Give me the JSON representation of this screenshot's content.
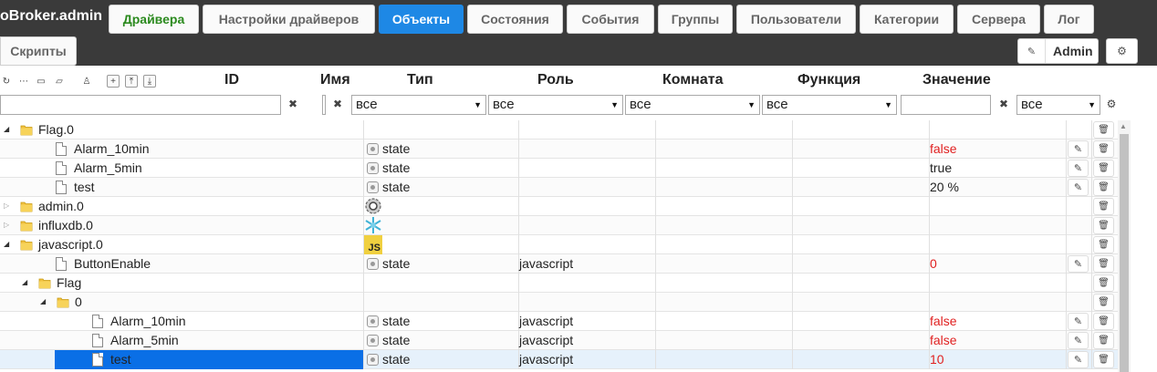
{
  "brand": "oBroker.admin",
  "tabs": [
    {
      "label": "Драйвера"
    },
    {
      "label": "Настройки драйверов"
    },
    {
      "label": "Объекты"
    },
    {
      "label": "Состояния"
    },
    {
      "label": "События"
    },
    {
      "label": "Группы"
    },
    {
      "label": "Пользователи"
    },
    {
      "label": "Категории"
    },
    {
      "label": "Сервера"
    },
    {
      "label": "Лог"
    },
    {
      "label": "Скрипты"
    }
  ],
  "active_tab": "Объекты",
  "user": {
    "name": "Admin"
  },
  "colors": {
    "topbar": "#3a3a3a",
    "active_tab": "#1e88e5",
    "first_tab_text": "#2b8a1e",
    "value_red": "#e02020",
    "selection": "#0a6fe6"
  },
  "columns": {
    "id": "ID",
    "name": "Имя",
    "type": "Тип",
    "role": "Роль",
    "room": "Комната",
    "function": "Функция",
    "value": "Значение"
  },
  "filters": {
    "id": "",
    "name": "",
    "type": "все",
    "role": "все",
    "room": "все",
    "function": "все",
    "value": "",
    "last": "все"
  },
  "toolbar_icons": [
    "refresh-icon",
    "list-icon",
    "folder-icon",
    "folder-open-icon",
    "user-icon",
    "plus-icon",
    "upload-icon",
    "download-icon"
  ],
  "rows": [
    {
      "id": "Flag.0",
      "kind": "folder",
      "level": 0,
      "expand": "open",
      "type": "",
      "role": "",
      "value": "",
      "value_color": "",
      "icon": "",
      "edit": false
    },
    {
      "id": "Alarm_10min",
      "kind": "file",
      "level": 1,
      "expand": "",
      "type": "state",
      "role": "",
      "value": "false",
      "value_color": "red",
      "icon": "state-icon",
      "edit": true
    },
    {
      "id": "Alarm_5min",
      "kind": "file",
      "level": 1,
      "expand": "",
      "type": "state",
      "role": "",
      "value": "true",
      "value_color": "",
      "icon": "state-icon",
      "edit": true
    },
    {
      "id": "test",
      "kind": "file",
      "level": 1,
      "expand": "",
      "type": "state",
      "role": "",
      "value": "20 %",
      "value_color": "",
      "icon": "state-icon",
      "edit": true
    },
    {
      "id": "admin.0",
      "kind": "folder",
      "level": 0,
      "expand": "closed",
      "type": "",
      "role": "",
      "value": "",
      "value_color": "",
      "icon": "admin-gear-icon",
      "edit": false
    },
    {
      "id": "influxdb.0",
      "kind": "folder",
      "level": 0,
      "expand": "closed",
      "type": "",
      "role": "",
      "value": "",
      "value_color": "",
      "icon": "influxdb-icon",
      "edit": false
    },
    {
      "id": "javascript.0",
      "kind": "folder",
      "level": 0,
      "expand": "open",
      "type": "",
      "role": "",
      "value": "",
      "value_color": "",
      "icon": "javascript-icon",
      "icon_text": "JS",
      "edit": false
    },
    {
      "id": "ButtonEnable",
      "kind": "file",
      "level": 1,
      "expand": "",
      "type": "state",
      "role": "javascript",
      "value": "0",
      "value_color": "red",
      "icon": "state-icon",
      "edit": true
    },
    {
      "id": "Flag",
      "kind": "folder",
      "level": 1,
      "expand": "open",
      "type": "",
      "role": "",
      "value": "",
      "value_color": "",
      "icon": "",
      "edit": false
    },
    {
      "id": "0",
      "kind": "folder",
      "level": 2,
      "expand": "open",
      "type": "",
      "role": "",
      "value": "",
      "value_color": "",
      "icon": "",
      "edit": false
    },
    {
      "id": "Alarm_10min",
      "kind": "file",
      "level": 3,
      "expand": "",
      "type": "state",
      "role": "javascript",
      "value": "false",
      "value_color": "red",
      "icon": "state-icon",
      "edit": true
    },
    {
      "id": "Alarm_5min",
      "kind": "file",
      "level": 3,
      "expand": "",
      "type": "state",
      "role": "javascript",
      "value": "false",
      "value_color": "red",
      "icon": "state-icon",
      "edit": true
    },
    {
      "id": "test",
      "kind": "file",
      "level": 3,
      "expand": "",
      "type": "state",
      "role": "javascript",
      "value": "10",
      "value_color": "red",
      "icon": "state-icon",
      "edit": true,
      "selected": true
    }
  ]
}
